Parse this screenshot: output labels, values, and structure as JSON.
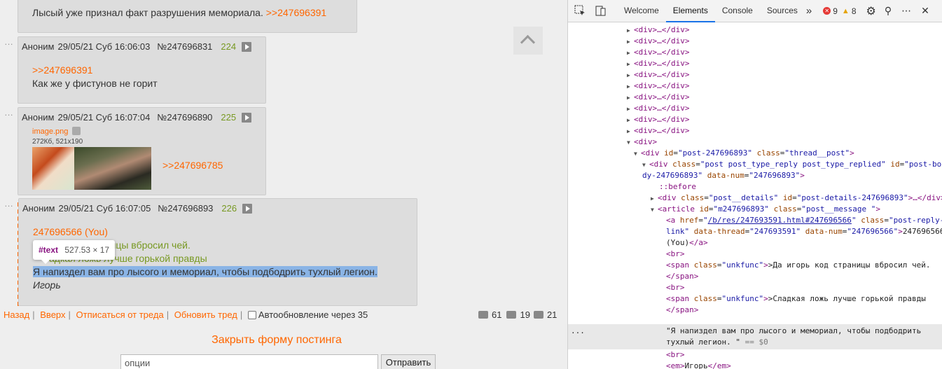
{
  "thread": {
    "top_post": {
      "text": "Лысый уже признал факт разрушения мемориала.",
      "reply_ref": ">>247696391"
    },
    "posts": [
      {
        "author": "Аноним",
        "date": "29/05/21 Суб 16:06:03",
        "num": "№247696831",
        "count": "224",
        "reply_ref": ">>247696391",
        "text": "Как же у фистунов не горит"
      },
      {
        "author": "Аноним",
        "date": "29/05/21 Суб 16:07:04",
        "num": "№247696890",
        "count": "225",
        "file_name": "image.png",
        "file_meta": "272Кб, 521x190",
        "reply_ref": ">>247696785"
      },
      {
        "author": "Аноним",
        "date": "29/05/21 Суб 16:07:05",
        "num": "№247696893",
        "count": "226",
        "reply_ref": "247696566 (You)",
        "line1": "Да игорь код страницы вбросил чей.",
        "line1_visible": "аницы вбросил чей.",
        "line2_visible": "адкая ложь лучше горькой правды",
        "line3": "Я напиздел вам про лысого и мемориал, чтобы подбодрить тухлый легион.",
        "signature": "Игорь"
      }
    ]
  },
  "tooltip": {
    "name": "#text",
    "size": "527.53 × 17"
  },
  "nav": {
    "back": "Назад",
    "up": "Вверх",
    "unsubscribe": "Отписаться от треда",
    "refresh": "Обновить тред",
    "autoupdate": "Автообновление через 35"
  },
  "stats": {
    "posts": "61",
    "images": "19",
    "users": "21"
  },
  "form": {
    "close_label": "Закрыть форму постинга",
    "options_placeholder": "опции",
    "send_label": "Отправить"
  },
  "devtools": {
    "tabs": [
      "Welcome",
      "Elements",
      "Console",
      "Sources"
    ],
    "active_tab": "Elements",
    "errors": "9",
    "warnings": "8",
    "collapsed_div": "<div>…</div>",
    "open_div": "<div>",
    "post_div": {
      "tag": "div",
      "id": "post-247696893",
      "class": "thread__post"
    },
    "post_inner": {
      "class": "post post_type_reply post_type_replied",
      "id_a": "post-bo",
      "id_b": "dy-247696893",
      "data_num": "247696893"
    },
    "before": "::before",
    "details": {
      "class": "post__details",
      "id": "post-details-247696893"
    },
    "article": {
      "id": "m247696893",
      "class": "post__message "
    },
    "link": {
      "href": "/b/res/247693591.html#247696566",
      "class_a": "post-reply-",
      "class_b": "link",
      "data_thread": "247693591",
      "data_num": "247696566",
      "text": "247696566",
      "text2": "(You)"
    },
    "br": "<br>",
    "span1_text": ">Да игорь код страницы вбросил чей.",
    "span2_text": ">Сладкая ложь лучше горькой правды",
    "span_close": "</span>",
    "text_node_a": "\"Я напиздел вам про лысого и мемориал, чтобы подбодрить",
    "text_node_b": "тухлый легион. \"",
    "dollar": "== $0",
    "ellipsis": "...",
    "em_text": "Игорь"
  }
}
